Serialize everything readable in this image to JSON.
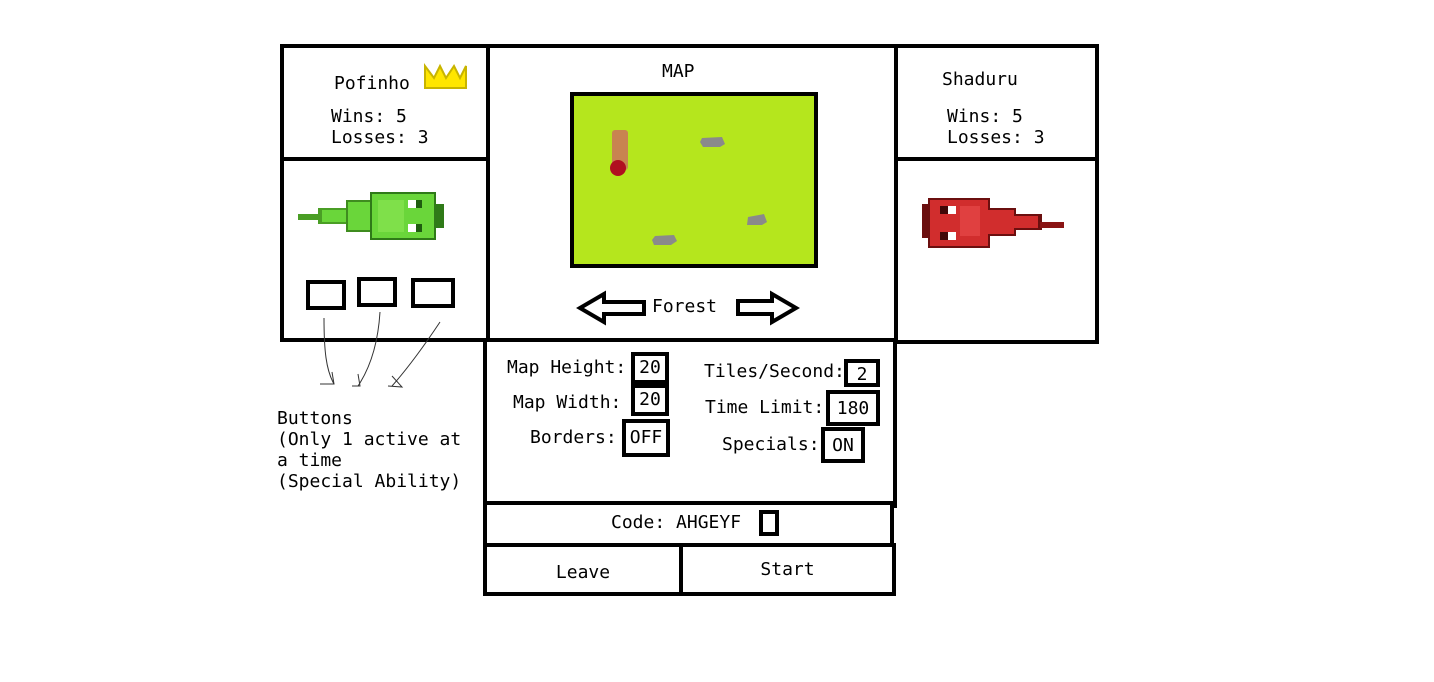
{
  "player_left": {
    "name": "Pofinho",
    "wins_label": "Wins: 5",
    "losses_label": "Losses: 3",
    "is_host": true
  },
  "player_right": {
    "name": "Shaduru",
    "wins_label": "Wins: 5",
    "losses_label": "Losses: 3"
  },
  "map": {
    "title": "MAP",
    "name": "Forest",
    "prev_icon": "arrow-left-icon",
    "next_icon": "arrow-right-icon",
    "ground_color": "#b5e61d"
  },
  "settings": {
    "map_height_label": "Map Height:",
    "map_height_value": "20",
    "map_width_label": "Map Width:",
    "map_width_value": "20",
    "borders_label": "Borders:",
    "borders_value": "OFF",
    "tiles_per_second_label": "Tiles/Second:",
    "tiles_per_second_value": "2",
    "time_limit_label": "Time Limit:",
    "time_limit_value": "180",
    "specials_label": "Specials:",
    "specials_value": "ON"
  },
  "code": {
    "label": "Code: AHGEYF",
    "copy_icon": "copy-icon"
  },
  "actions": {
    "leave_label": "Leave",
    "start_label": "Start"
  },
  "annotation": {
    "line1": "Buttons",
    "line2": "(Only 1 active at",
    "line3": "a time",
    "line4": "(Special Ability)"
  },
  "colors": {
    "snake_green": "#6ad63a",
    "snake_red": "#d12d2d",
    "crown": "#ffe600",
    "rock": "#8a8a8a"
  }
}
